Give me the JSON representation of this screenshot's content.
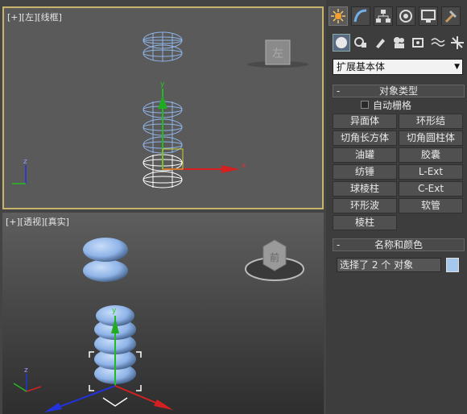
{
  "viewport_left": {
    "label": "[+][左][线框]",
    "viewcube_face": "左",
    "axes": {
      "y": "y",
      "x": "x",
      "z": "z"
    }
  },
  "viewport_perspective": {
    "label": "[+][透视][真实]",
    "viewcube_face": "前",
    "axes": {
      "y": "y",
      "z": "z"
    }
  },
  "command_panel": {
    "tabs": [
      "create-icon",
      "modify-icon",
      "hierarchy-icon",
      "motion-icon",
      "display-icon",
      "utilities-icon"
    ],
    "subtabs": [
      "geometry-icon",
      "shapes-icon",
      "lights-icon",
      "cameras-icon",
      "helpers-icon",
      "spacewarps-icon",
      "systems-icon"
    ],
    "category_select": "扩展基本体",
    "object_type_rollout": {
      "title": "对象类型",
      "collapse": "-",
      "autogrid_label": "自动栅格",
      "buttons": [
        "异面体",
        "环形结",
        "切角长方体",
        "切角圆柱体",
        "油罐",
        "胶囊",
        "纺锤",
        "L-Ext",
        "球棱柱",
        "C-Ext",
        "环形波",
        "软管",
        "棱柱"
      ]
    },
    "name_color_rollout": {
      "title": "名称和颜色",
      "collapse": "-",
      "name_value": "选择了 2 个 对象",
      "swatch_color": "#a6c8ee"
    }
  },
  "colors": {
    "selected_frame": "#c8b46a",
    "object_blue": "#8fb4e8",
    "wire_white": "#ffffff",
    "axis_red": "#d42020",
    "axis_green": "#22bb22",
    "axis_blue": "#2233dd"
  }
}
